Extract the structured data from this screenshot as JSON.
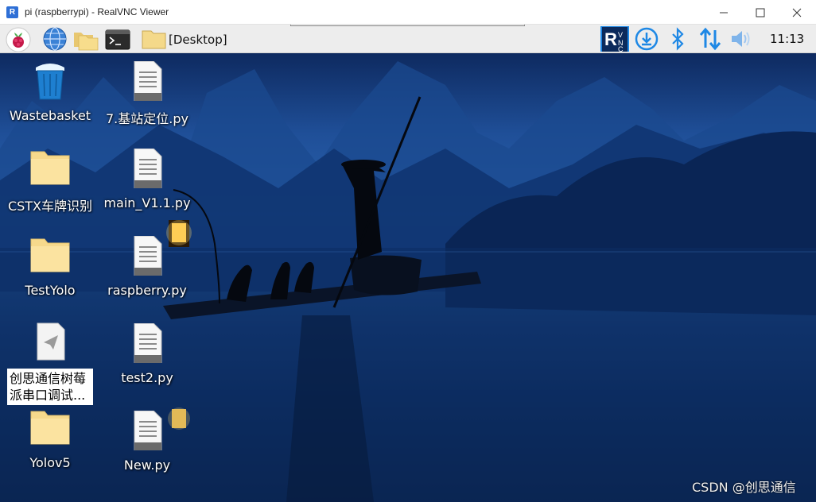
{
  "window": {
    "app_icon_text": "R",
    "title": "pi (raspberrypi) - RealVNC Viewer"
  },
  "taskbar": {
    "desktop_label": "[Desktop]",
    "clock": "11:13",
    "items": [
      "raspberry-menu-icon",
      "web-browser-icon",
      "file-manager-icon",
      "terminal-icon"
    ],
    "tray": [
      "realvnc-tray-icon",
      "download-icon",
      "bluetooth-icon",
      "network-arrows-icon",
      "volume-icon"
    ],
    "accent_color": "#1e88e5"
  },
  "desktop": {
    "icons": [
      {
        "label": "Wastebasket",
        "type": "trash"
      },
      {
        "label": "7.基站定位.py",
        "type": "file"
      },
      {
        "label": "CSTX车牌识别",
        "type": "folder"
      },
      {
        "label": "main_V1.1.py",
        "type": "file"
      },
      {
        "label": "TestYolo",
        "type": "folder"
      },
      {
        "label": "raspberry.py",
        "type": "file"
      },
      {
        "label": "创思通信树莓派串口调试...",
        "type": "document",
        "selected": true
      },
      {
        "label": "test2.py",
        "type": "file"
      },
      {
        "label": "Yolov5",
        "type": "folder"
      },
      {
        "label": "New.py",
        "type": "file"
      }
    ]
  },
  "watermark": "CSDN @创思通信"
}
